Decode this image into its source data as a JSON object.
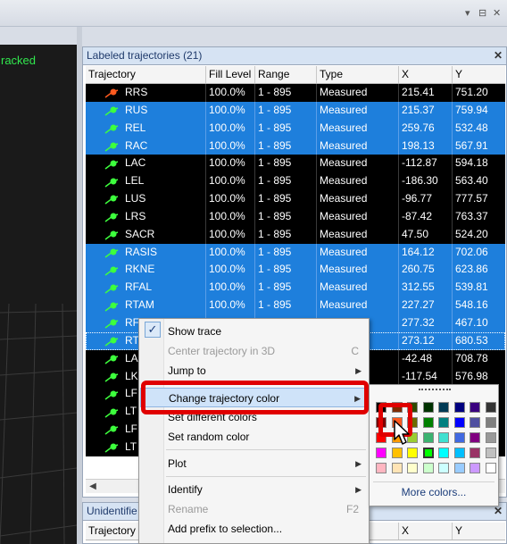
{
  "app": {
    "view3d_label": "racked",
    "window_controls": [
      "▾",
      "⊟",
      "✕"
    ]
  },
  "labeled_panel": {
    "title": "Labeled trajectories (21)",
    "close": "✕",
    "columns": [
      "Trajectory",
      "Fill Level",
      "Range",
      "Type",
      "X",
      "Y"
    ],
    "rows": [
      {
        "name": "RRS",
        "fill": "100.0%",
        "range": "1 - 895",
        "type": "Measured",
        "x": "215.41",
        "y": "751.20",
        "style": "black",
        "marker": "#ff5a1f"
      },
      {
        "name": "RUS",
        "fill": "100.0%",
        "range": "1 - 895",
        "type": "Measured",
        "x": "215.37",
        "y": "759.94",
        "style": "blue",
        "marker": "#3dff3d"
      },
      {
        "name": "REL",
        "fill": "100.0%",
        "range": "1 - 895",
        "type": "Measured",
        "x": "259.76",
        "y": "532.48",
        "style": "blue",
        "marker": "#3dff3d"
      },
      {
        "name": "RAC",
        "fill": "100.0%",
        "range": "1 - 895",
        "type": "Measured",
        "x": "198.13",
        "y": "567.91",
        "style": "blue",
        "marker": "#3dff3d"
      },
      {
        "name": "LAC",
        "fill": "100.0%",
        "range": "1 - 895",
        "type": "Measured",
        "x": "-112.87",
        "y": "594.18",
        "style": "black",
        "marker": "#3dff3d"
      },
      {
        "name": "LEL",
        "fill": "100.0%",
        "range": "1 - 895",
        "type": "Measured",
        "x": "-186.30",
        "y": "563.40",
        "style": "black",
        "marker": "#3dff3d"
      },
      {
        "name": "LUS",
        "fill": "100.0%",
        "range": "1 - 895",
        "type": "Measured",
        "x": "-96.77",
        "y": "777.57",
        "style": "black",
        "marker": "#3dff3d"
      },
      {
        "name": "LRS",
        "fill": "100.0%",
        "range": "1 - 895",
        "type": "Measured",
        "x": "-87.42",
        "y": "763.37",
        "style": "black",
        "marker": "#3dff3d"
      },
      {
        "name": "SACR",
        "fill": "100.0%",
        "range": "1 - 895",
        "type": "Measured",
        "x": "47.50",
        "y": "524.20",
        "style": "black",
        "marker": "#3dff3d"
      },
      {
        "name": "RASIS",
        "fill": "100.0%",
        "range": "1 - 895",
        "type": "Measured",
        "x": "164.12",
        "y": "702.06",
        "style": "blue",
        "marker": "#3dff3d"
      },
      {
        "name": "RKNE",
        "fill": "100.0%",
        "range": "1 - 895",
        "type": "Measured",
        "x": "260.75",
        "y": "623.86",
        "style": "blue",
        "marker": "#3dff3d"
      },
      {
        "name": "RFAL",
        "fill": "100.0%",
        "range": "1 - 895",
        "type": "Measured",
        "x": "312.55",
        "y": "539.81",
        "style": "blue",
        "marker": "#3dff3d"
      },
      {
        "name": "RTAM",
        "fill": "100.0%",
        "range": "1 - 895",
        "type": "Measured",
        "x": "227.27",
        "y": "548.16",
        "style": "blue",
        "marker": "#3dff3d"
      },
      {
        "name": "RFCC",
        "fill": "100.0%",
        "range": "1 - 895",
        "type": "Measured",
        "x": "277.32",
        "y": "467.10",
        "style": "blue",
        "marker": "#3dff3d"
      },
      {
        "name": "RT",
        "fill": "100.0%",
        "range": "1 - 895",
        "type": "Measured",
        "x": "273.12",
        "y": "680.53",
        "style": "blue",
        "marker": "#3dff3d",
        "focus": true
      },
      {
        "name": "LA",
        "fill": "",
        "range": "",
        "type": "",
        "x": "-42.48",
        "y": "708.78",
        "style": "black",
        "marker": "#3dff3d"
      },
      {
        "name": "LK",
        "fill": "",
        "range": "",
        "type": "",
        "x": "-117.54",
        "y": "576.98",
        "style": "black",
        "marker": "#3dff3d"
      },
      {
        "name": "LF",
        "fill": "",
        "range": "",
        "type": "",
        "x": "",
        "y": "",
        "style": "black",
        "marker": "#3dff3d"
      },
      {
        "name": "LT",
        "fill": "",
        "range": "",
        "type": "",
        "x": "",
        "y": "",
        "style": "black",
        "marker": "#3dff3d"
      },
      {
        "name": "LF",
        "fill": "",
        "range": "",
        "type": "",
        "x": "",
        "y": "",
        "style": "black",
        "marker": "#3dff3d"
      },
      {
        "name": "LT",
        "fill": "",
        "range": "",
        "type": "",
        "x": "",
        "y": "",
        "style": "black",
        "marker": "#3dff3d"
      }
    ],
    "scroll_left": "◀"
  },
  "unidentified_panel": {
    "title": "Unidentifie",
    "close": "✕",
    "columns": [
      "Trajectory",
      "",
      "",
      "",
      "X",
      "Y"
    ]
  },
  "context_menu": {
    "items": [
      {
        "label": "Show trace",
        "checked": true
      },
      {
        "label": "Center trajectory in 3D",
        "shortcut": "C",
        "disabled": true
      },
      {
        "label": "Jump to",
        "submenu": true
      },
      {
        "label": "Change trajectory color",
        "submenu": true,
        "highlighted": true
      },
      {
        "label": "Set different colors"
      },
      {
        "label": "Set random color"
      },
      {
        "label": "Plot",
        "submenu": true
      },
      {
        "label": "Identify",
        "submenu": true
      },
      {
        "label": "Rename",
        "shortcut": "F2",
        "disabled": true
      },
      {
        "label": "Add prefix to selection..."
      }
    ],
    "check_glyph": "✓",
    "submenu_glyph": "▶"
  },
  "color_palette": {
    "more_colors": "More colors...",
    "colors": [
      [
        "#000000",
        "#7f2a00",
        "#2e4a00",
        "#003200",
        "#003a55",
        "#00007f",
        "#3a007f",
        "#333333"
      ],
      [
        "#7f0000",
        "#ff5a1f",
        "#6b6b00",
        "#008000",
        "#008080",
        "#0000ff",
        "#5050a0",
        "#7f7f7f"
      ],
      [
        "#ff0000",
        "#ff9a00",
        "#9acd32",
        "#3cb371",
        "#40e0d0",
        "#4169e1",
        "#800080",
        "#999999"
      ],
      [
        "#ff00ff",
        "#ffc000",
        "#ffff00",
        "#00ff00",
        "#00ffff",
        "#00bfff",
        "#993366",
        "#c0c0c0"
      ],
      [
        "#ffb6c1",
        "#ffe4b5",
        "#ffffcc",
        "#ccffcc",
        "#ccffff",
        "#99ccff",
        "#cc99ff",
        "#ffffff"
      ]
    ]
  }
}
